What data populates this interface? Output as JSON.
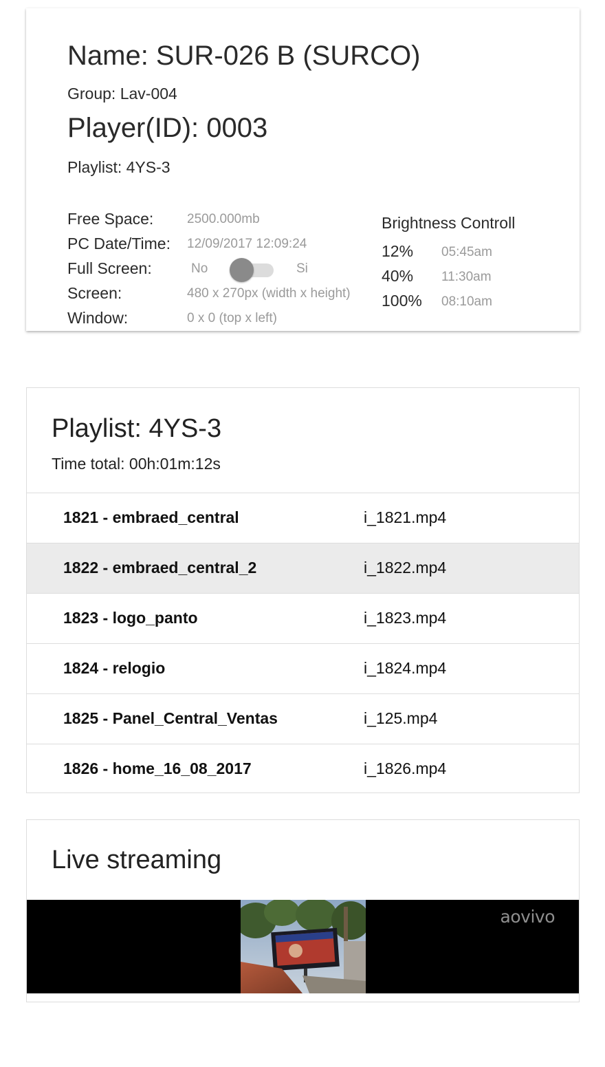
{
  "player": {
    "name": "Name: SUR-026 B (SURCO)",
    "group": "Group: Lav-004",
    "player_id": "Player(ID): 0003",
    "playlist": "Playlist: 4YS-3"
  },
  "specs": {
    "free_space_label": "Free Space:",
    "free_space_value": "2500.000mb",
    "datetime_label": "PC Date/Time:",
    "datetime_value": "12/09/2017 12:09:24",
    "fullscreen_label": "Full Screen:",
    "fullscreen_off_label": "No",
    "fullscreen_on_label": "Si",
    "fullscreen_enabled": false,
    "screen_label": "Screen:",
    "screen_value": "480 x 270px (width x height)",
    "window_label": "Window:",
    "window_value": "0 x 0 (top x left)"
  },
  "brightness": {
    "title": "Brightness Controll",
    "schedule": [
      {
        "percent": "12%",
        "time": "05:45am"
      },
      {
        "percent": "40%",
        "time": "11:30am"
      },
      {
        "percent": "100%",
        "time": "08:10am"
      }
    ]
  },
  "playlist": {
    "title": "Playlist: 4YS-3",
    "total": "Time total: 00h:01m:12s",
    "items": [
      {
        "name": "1821 - embraed_central",
        "file": "i_1821.mp4"
      },
      {
        "name": "1822 - embraed_central_2",
        "file": "i_1822.mp4",
        "active": true
      },
      {
        "name": "1823 - logo_panto",
        "file": "i_1823.mp4"
      },
      {
        "name": "1824 - relogio",
        "file": "i_1824.mp4"
      },
      {
        "name": "1825 - Panel_Central_Ventas",
        "file": "i_125.mp4"
      },
      {
        "name": "1826 - home_16_08_2017",
        "file": "i_1826.mp4"
      }
    ]
  },
  "live": {
    "title": "Live streaming",
    "badge": "aovivo"
  },
  "colors": {
    "muted_text": "#9a9a9a",
    "active_row": "#ebebeb",
    "toggle_knob": "#8a8a8a",
    "toggle_track": "#dcdcdc"
  }
}
